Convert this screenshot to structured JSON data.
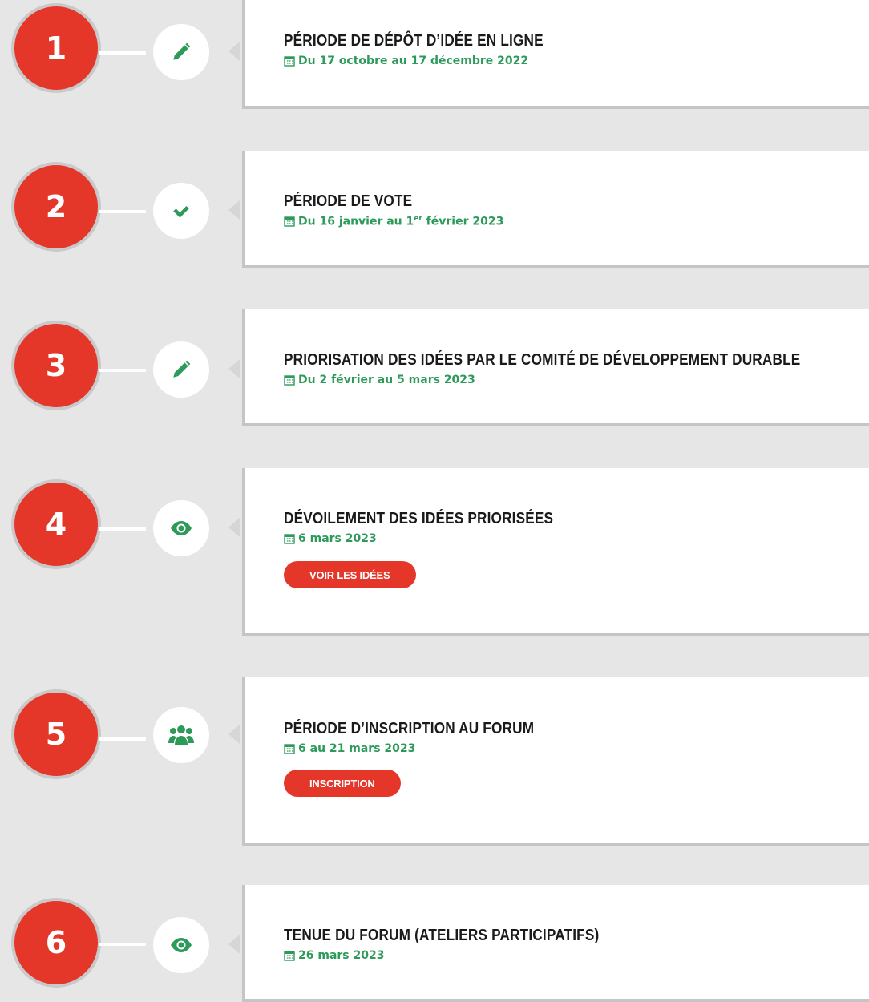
{
  "colors": {
    "accent_red": "#e5362a",
    "green": "#2d9a5a",
    "background": "#e6e6e6"
  },
  "steps": [
    {
      "number": "1",
      "icon": "pencil-icon",
      "title": "PÉRIODE DE DÉPÔT D’IDÉE EN LIGNE",
      "date": "Du 17 octobre au 17 décembre 2022"
    },
    {
      "number": "2",
      "icon": "check-icon",
      "title": "PÉRIODE DE VOTE",
      "date_prefix": "Du 16 janvier au 1",
      "date_sup": "er",
      "date_suffix": " février 2023"
    },
    {
      "number": "3",
      "icon": "pencil-icon",
      "title": "PRIORISATION DES IDÉES PAR LE COMITÉ DE DÉVELOPPEMENT DURABLE",
      "date": "Du 2 février au 5 mars 2023"
    },
    {
      "number": "4",
      "icon": "eye-icon",
      "title": "DÉVOILEMENT DES IDÉES PRIORISÉES",
      "date": "6 mars 2023",
      "button": "VOIR LES IDÉES"
    },
    {
      "number": "5",
      "icon": "users-icon",
      "title": "PÉRIODE D’INSCRIPTION AU FORUM",
      "date": "6 au 21 mars 2023",
      "button": "INSCRIPTION"
    },
    {
      "number": "6",
      "icon": "eye-icon",
      "title": "TENUE DU FORUM (ATELIERS PARTICIPATIFS)",
      "date": "26 mars 2023"
    }
  ]
}
